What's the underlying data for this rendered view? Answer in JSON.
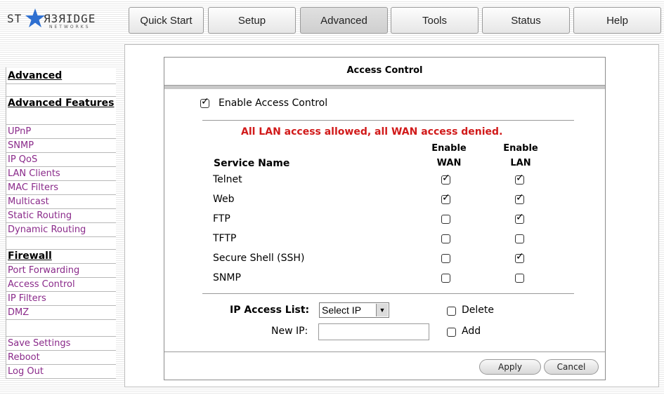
{
  "logo": {
    "brand_left": "ST",
    "brand_right": "ЯЗЯIDGE",
    "sub": "NETWORKS"
  },
  "nav_tabs": [
    "Quick Start",
    "Setup",
    "Advanced",
    "Tools",
    "Status",
    "Help"
  ],
  "active_tab": "Advanced",
  "sidebar": {
    "title": "Advanced",
    "features_heading": "Advanced Features",
    "features": [
      "UPnP",
      "SNMP",
      "IP QoS",
      "LAN Clients",
      "MAC Filters",
      "Multicast",
      "Static Routing",
      "Dynamic Routing"
    ],
    "firewall_heading": "Firewall",
    "firewall": [
      "Port Forwarding",
      "Access Control",
      "IP Filters",
      "DMZ"
    ],
    "actions": [
      "Save Settings",
      "Reboot",
      "Log Out"
    ]
  },
  "panel": {
    "title": "Access Control",
    "enable_label": "Enable Access Control",
    "enable_checked": true,
    "status_message": "All LAN access allowed, all WAN access denied.",
    "col_service": "Service Name",
    "col_wan_1": "Enable",
    "col_wan_2": "WAN",
    "col_lan_1": "Enable",
    "col_lan_2": "LAN",
    "services": [
      {
        "name": "Telnet",
        "wan": true,
        "lan": true
      },
      {
        "name": "Web",
        "wan": true,
        "lan": true
      },
      {
        "name": "FTP",
        "wan": false,
        "lan": true
      },
      {
        "name": "TFTP",
        "wan": false,
        "lan": false
      },
      {
        "name": "Secure Shell (SSH)",
        "wan": false,
        "lan": true
      },
      {
        "name": "SNMP",
        "wan": false,
        "lan": false
      }
    ],
    "ip_access_label": "IP Access List:",
    "ip_select_value": "Select IP",
    "delete_label": "Delete",
    "new_ip_label": "New IP:",
    "new_ip_value": "",
    "add_label": "Add",
    "apply_label": "Apply",
    "cancel_label": "Cancel"
  }
}
